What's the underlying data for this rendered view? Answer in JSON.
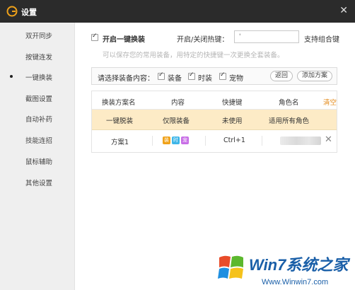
{
  "window": {
    "title": "设置",
    "close_glyph": "✕"
  },
  "sidebar": {
    "items": [
      {
        "label": "双开同步",
        "active": false
      },
      {
        "label": "按键连发",
        "active": false
      },
      {
        "label": "一键换装",
        "active": true
      },
      {
        "label": "截图设置",
        "active": false
      },
      {
        "label": "自动补药",
        "active": false
      },
      {
        "label": "技能连招",
        "active": false
      },
      {
        "label": "鼠标辅助",
        "active": false
      },
      {
        "label": "其他设置",
        "active": false
      }
    ]
  },
  "main": {
    "enable_label": "开启一键换装",
    "hotkey_label": "开启/关闭热键：",
    "hotkey_value": "'",
    "combo_hint": "支持组合键",
    "description": "可以保存您的常用装备，用特定的快捷键一次更换全套装备。",
    "selector": {
      "prompt": "请选择装备内容：",
      "options": [
        "装备",
        "时装",
        "宠物"
      ],
      "back_button": "返回",
      "add_button": "添加方案"
    },
    "table": {
      "headers": [
        "换装方案名",
        "内容",
        "快捷键",
        "角色名"
      ],
      "clear_label": "清空",
      "rows": [
        {
          "name": "一键脱装",
          "content": "仅限装备",
          "shortcut": "未使用",
          "role": "适用所有角色"
        },
        {
          "name": "方案1",
          "content_tags": [
            "装",
            "时",
            "宠"
          ],
          "shortcut": "Ctrl+1",
          "role": "",
          "delete": "✕"
        }
      ]
    }
  },
  "colors": {
    "titlebar": "#2b2b2b",
    "accent": "#e38a18",
    "tag_equip": "#f0a21a",
    "tag_fashion": "#3fb6e8",
    "tag_pet": "#c86ee6",
    "highlight_row": "#fdebc6"
  },
  "watermark": {
    "brand": "Win7系统之家",
    "url": "Www.Winwin7.com"
  }
}
